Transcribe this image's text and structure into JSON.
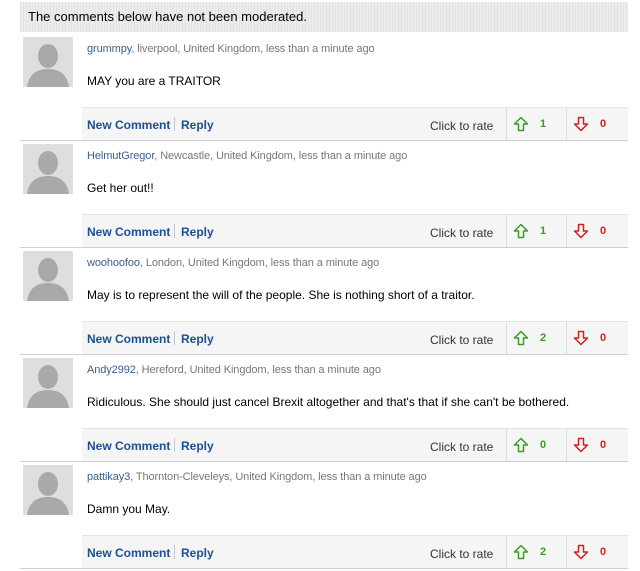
{
  "notice": "The comments below have not been moderated.",
  "actions": {
    "new_comment": "New Comment",
    "reply": "Reply",
    "rate_label": "Click to rate"
  },
  "colors": {
    "username": "#3b5f8a",
    "link": "#1d4f91",
    "up": "#3a9d23",
    "down": "#d02020"
  },
  "comments": [
    {
      "user": "grummpy",
      "meta": ", liverpool, United Kingdom, less than a minute ago",
      "text": "MAY you are a TRAITOR",
      "up": "1",
      "down": "0"
    },
    {
      "user": "HelmutGregor",
      "meta": ", Newcastle, United Kingdom, less than a minute ago",
      "text": "Get her out!!",
      "up": "1",
      "down": "0"
    },
    {
      "user": "woohoofoo",
      "meta": ", London, United Kingdom, less than a minute ago",
      "text": "May is to represent the will of the people. She is nothing short of a traitor.",
      "up": "2",
      "down": "0"
    },
    {
      "user": "Andy2992",
      "meta": ", Hereford, United Kingdom, less than a minute ago",
      "text": "Ridiculous. She should just cancel Brexit altogether and that's that if she can't be bothered.",
      "up": "0",
      "down": "0"
    },
    {
      "user": "pattikay3",
      "meta": ", Thornton-Cleveleys, United Kingdom, less than a minute ago",
      "text": "Damn you May.",
      "up": "2",
      "down": "0"
    }
  ]
}
